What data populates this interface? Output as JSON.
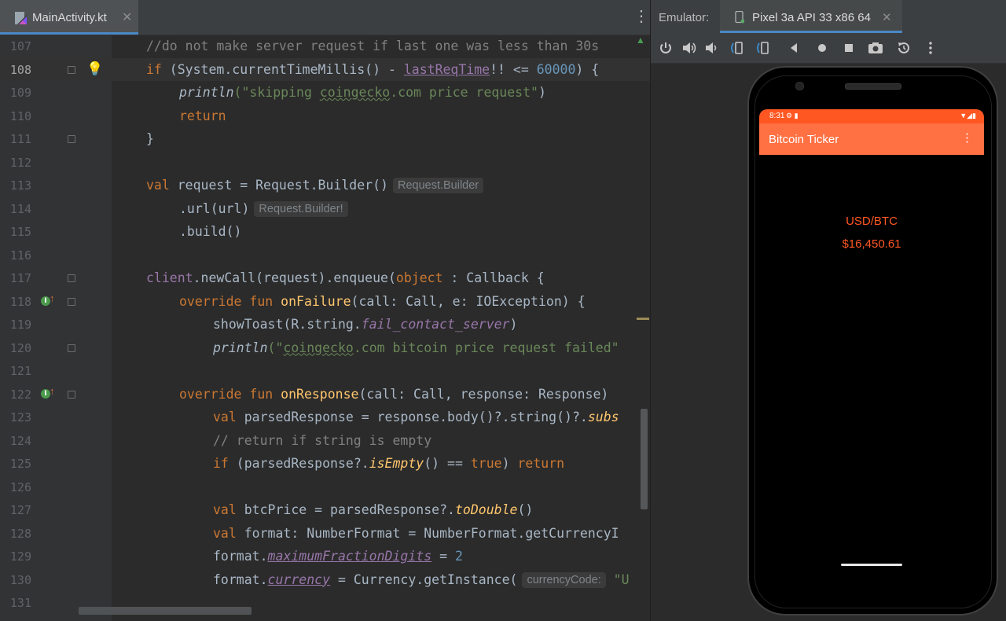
{
  "editor": {
    "tab": {
      "filename": "MainActivity.kt",
      "close": "✕"
    },
    "menu": "⋮",
    "current_line": "108",
    "lines": [
      {
        "n": "107",
        "t": ""
      },
      {
        "n": "108",
        "t": ""
      },
      {
        "n": "109",
        "t": ""
      },
      {
        "n": "110",
        "t": ""
      },
      {
        "n": "111",
        "t": ""
      },
      {
        "n": "112",
        "t": ""
      },
      {
        "n": "113",
        "t": ""
      },
      {
        "n": "114",
        "t": ""
      },
      {
        "n": "115",
        "t": ""
      },
      {
        "n": "116",
        "t": ""
      },
      {
        "n": "117",
        "t": ""
      },
      {
        "n": "118",
        "t": ""
      },
      {
        "n": "119",
        "t": ""
      },
      {
        "n": "120",
        "t": ""
      },
      {
        "n": "121",
        "t": ""
      },
      {
        "n": "122",
        "t": ""
      },
      {
        "n": "123",
        "t": ""
      },
      {
        "n": "124",
        "t": ""
      },
      {
        "n": "125",
        "t": ""
      },
      {
        "n": "126",
        "t": ""
      },
      {
        "n": "127",
        "t": ""
      },
      {
        "n": "128",
        "t": ""
      },
      {
        "n": "129",
        "t": ""
      },
      {
        "n": "130",
        "t": ""
      },
      {
        "n": "131",
        "t": ""
      }
    ],
    "code": {
      "l107": "//do not make server request if last one was less than 30s",
      "l108_a": "if",
      "l108_b": " (System.currentTimeMillis() - ",
      "l108_c": "lastReqTime",
      "l108_d": "!! <= ",
      "l108_e": "60000",
      "l108_f": ") {",
      "l109_a": "println",
      "l109_b": "(\"skipping ",
      "l109_c": "coingecko",
      "l109_d": ".com price request\"",
      "l109_e": ")",
      "l110": "return",
      "l111": "}",
      "l113_a": "val",
      "l113_b": " request = Request.Builder()",
      "l113_hint": "Request.Builder",
      "l114_a": ".url(url)",
      "l114_hint": "Request.Builder!",
      "l115": ".build()",
      "l117_a": "client",
      "l117_b": ".newCall(request).enqueue(",
      "l117_c": "object",
      "l117_d": " : Callback {",
      "l118_a": "override fun ",
      "l118_b": "onFailure",
      "l118_c": "(call: Call, e: IOException) {",
      "l119_a": "showToast(R.string.",
      "l119_b": "fail_contact_server",
      "l119_c": ")",
      "l120_a": "println",
      "l120_b": "(\"",
      "l120_c": "coingecko",
      "l120_d": ".com bitcoin price request failed\"",
      "l122_a": "override fun ",
      "l122_b": "onResponse",
      "l122_c": "(call: Call, response: Response)",
      "l123_a": "val",
      "l123_b": " parsedResponse = response.body()?.string()?.",
      "l123_c": "subs",
      "l124": "// return if string is empty",
      "l125_a": "if",
      "l125_b": " (parsedResponse?.",
      "l125_c": "isEmpty",
      "l125_d": "() == ",
      "l125_e": "true",
      "l125_f": ") ",
      "l125_g": "return",
      "l127_a": "val",
      "l127_b": " btcPrice = parsedResponse?.",
      "l127_c": "toDouble",
      "l127_d": "()",
      "l128_a": "val",
      "l128_b": " format: NumberFormat = NumberFormat.getCurrencyI",
      "l129_a": "format.",
      "l129_b": "maximumFractionDigits",
      "l129_c": " = ",
      "l129_d": "2",
      "l130_a": "format.",
      "l130_b": "currency",
      "l130_c": " = Currency.getInstance(",
      "l130_hint": "currencyCode:",
      "l130_d": " \"U"
    }
  },
  "emulator": {
    "label": "Emulator:",
    "device": "Pixel 3a API 33 x86 64",
    "close": "✕",
    "toolbar": [
      "power-icon",
      "volume-up-icon",
      "volume-down-icon",
      "rotate-left-icon",
      "rotate-right-icon",
      "back-icon",
      "home-icon",
      "overview-icon",
      "screenshot-icon",
      "snapshot-icon",
      "more-icon"
    ],
    "phone": {
      "status_time": "8:31",
      "status_icons": "⚙ ▮",
      "status_right": "▼◢▮",
      "app_title": "Bitcoin Ticker",
      "app_menu": "⋮",
      "pair": "USD/BTC",
      "price": "$16,450.61"
    }
  },
  "colors": {
    "accent": "#ff5722",
    "appbar": "#ff7043",
    "tab_underline": "#4a88c7"
  }
}
